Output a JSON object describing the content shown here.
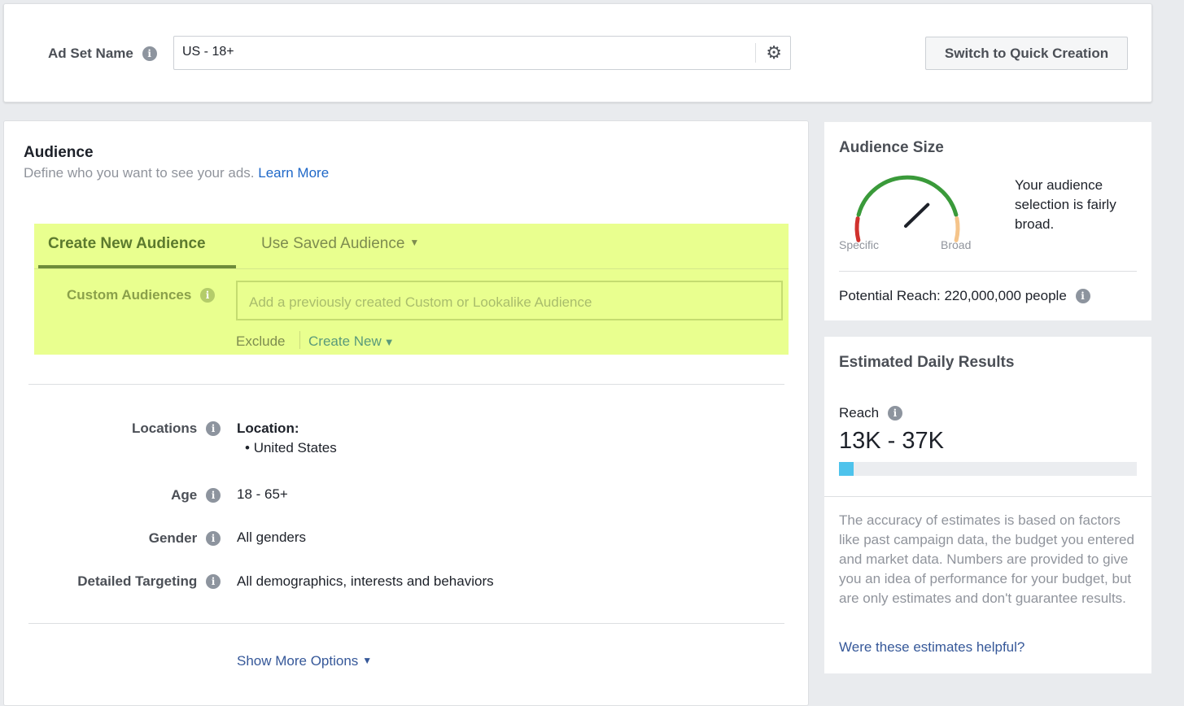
{
  "adset": {
    "label": "Ad Set Name",
    "info_icon": "i",
    "value": "US - 18+",
    "gear_icon": "⚙",
    "switch_button": "Switch to Quick Creation"
  },
  "audience": {
    "title": "Audience",
    "subtitle": "Define who you want to see your ads.",
    "learn_more": "Learn More",
    "tabs": {
      "create": "Create New Audience",
      "saved": "Use Saved Audience",
      "caret": "▼"
    },
    "custom": {
      "label": "Custom Audiences",
      "placeholder": "Add a previously created Custom or Lookalike Audience",
      "exclude": "Exclude",
      "create_new": "Create New",
      "caret": "▼"
    },
    "locations": {
      "label": "Locations",
      "heading": "Location:",
      "items": [
        "United States"
      ]
    },
    "age": {
      "label": "Age",
      "value": "18 - 65+"
    },
    "gender": {
      "label": "Gender",
      "value": "All genders"
    },
    "detailed": {
      "label": "Detailed Targeting",
      "value": "All demographics, interests and behaviors"
    },
    "more_options": "Show More Options",
    "more_caret": "▼"
  },
  "size": {
    "title": "Audience Size",
    "specific": "Specific",
    "broad": "Broad",
    "description": "Your audience selection is fairly broad.",
    "potential_reach": "Potential Reach: 220,000,000 people",
    "gauge_level": 0.72,
    "colors": {
      "low": "#d0312d",
      "mid": "#3a9a3a",
      "high": "#f5c48a",
      "needle": "#1d2129"
    }
  },
  "estimate": {
    "title": "Estimated Daily Results",
    "reach_label": "Reach",
    "reach_value": "13K - 37K",
    "reach_bar_fraction": 0.05,
    "bar_color": "#4ec3ec",
    "disclaimer": "The accuracy of estimates is based on factors like past campaign data, the budget you entered and market data. Numbers are provided to give you an idea of performance for your budget, but are only estimates and don't guarantee results.",
    "helpful_link": "Were these estimates helpful?"
  }
}
